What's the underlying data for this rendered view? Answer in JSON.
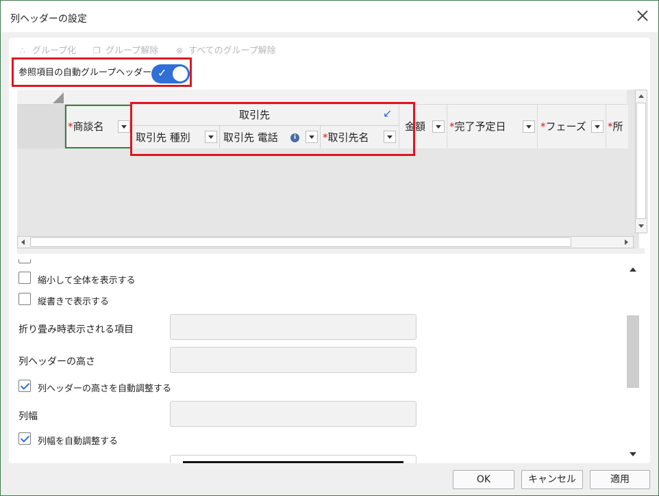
{
  "window": {
    "title": "列ヘッダーの設定"
  },
  "toolbar": {
    "group_label": "グループ化",
    "ungroup_label": "グループ解除",
    "ungroup_all_label": "すべてのグループ解除"
  },
  "auto_group": {
    "label": "参照項目の自動グループヘッダー",
    "enabled": true
  },
  "grid": {
    "columns": [
      {
        "label": "商談名",
        "required": true
      },
      {
        "label": "金額",
        "required": false
      },
      {
        "label": "完了予定日",
        "required": true
      },
      {
        "label": "フェーズ",
        "required": true
      },
      {
        "label": "所",
        "required": true
      }
    ],
    "group": {
      "title": "取引先",
      "columns": [
        {
          "label": "取引先 種別",
          "required": false
        },
        {
          "label": "取引先 電話",
          "required": false,
          "info": true
        },
        {
          "label": "取引先名",
          "required": true
        }
      ]
    },
    "required_mark": "*",
    "info_mark": "i"
  },
  "options": {
    "shrink_to_fit": {
      "label": "縮小して全体を表示する",
      "checked": false
    },
    "vertical_text": {
      "label": "縦書きで表示する",
      "checked": false
    },
    "collapsed_item": {
      "label": "折り畳み時表示される項目",
      "value": ""
    },
    "header_height": {
      "label": "列ヘッダーの高さ",
      "value": ""
    },
    "auto_header_height": {
      "label": "列ヘッダーの高さを自動調整する",
      "checked": true
    },
    "column_width": {
      "label": "列幅",
      "value": ""
    },
    "auto_column_width": {
      "label": "列幅を自動調整する",
      "checked": true
    }
  },
  "buttons": {
    "ok": "OK",
    "cancel": "キャンセル",
    "apply": "適用"
  },
  "colors": {
    "accent": "#2f6fd6",
    "highlight": "#e0141e",
    "required": "#e0141e",
    "window_border": "#3c7a4c"
  }
}
